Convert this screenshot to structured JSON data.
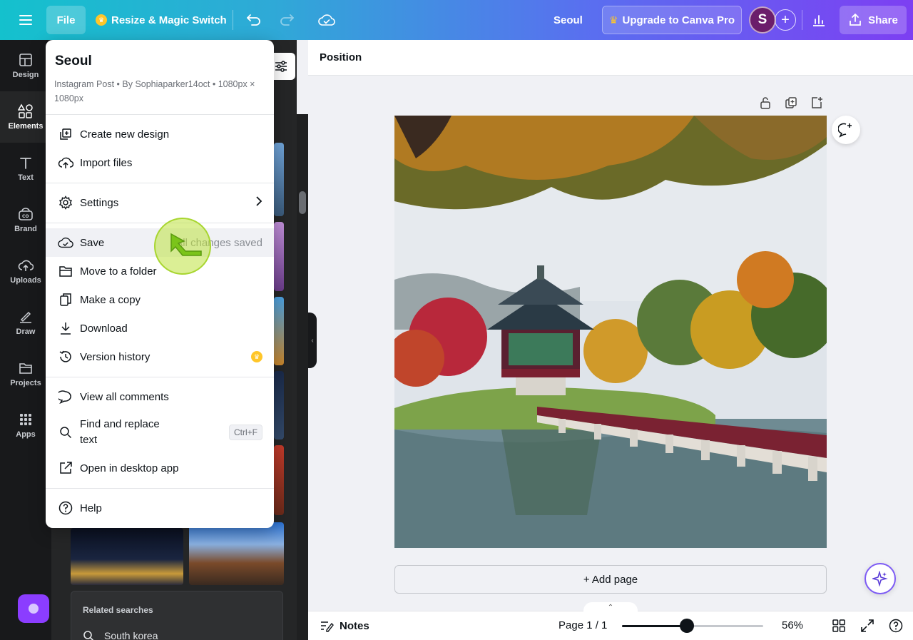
{
  "topbar": {
    "file_label": "File",
    "resize_label": "Resize & Magic Switch",
    "doc_title": "Seoul",
    "upgrade_label": "Upgrade to Canva Pro",
    "avatar_initial": "S",
    "share_label": "Share",
    "icons": [
      "menu-icon",
      "crown-icon",
      "undo-icon",
      "redo-icon",
      "cloud-check-icon",
      "plus-icon",
      "chart-icon",
      "share-icon"
    ]
  },
  "rail": {
    "items": [
      {
        "label": "Design",
        "icon": "layout-icon"
      },
      {
        "label": "Elements",
        "icon": "shapes-icon",
        "active": true
      },
      {
        "label": "Text",
        "icon": "text-icon"
      },
      {
        "label": "Brand",
        "icon": "brand-icon"
      },
      {
        "label": "Uploads",
        "icon": "upload-cloud-icon"
      },
      {
        "label": "Draw",
        "icon": "pen-icon"
      },
      {
        "label": "Projects",
        "icon": "folder-icon"
      },
      {
        "label": "Apps",
        "icon": "grid-icon"
      }
    ]
  },
  "panel": {
    "related_title": "Related searches",
    "related_items": [
      "South korea"
    ]
  },
  "menu": {
    "title": "Seoul",
    "meta": "Instagram Post • By Sophiaparker14oct • 1080px × 1080px",
    "items": [
      {
        "label": "Create new design",
        "icon": "create-design-icon"
      },
      {
        "label": "Import files",
        "icon": "import-cloud-icon"
      },
      {
        "label": "Settings",
        "icon": "gear-icon",
        "right": "chevron-right-icon"
      },
      {
        "label": "Save",
        "icon": "cloud-check-icon",
        "right_text": "All changes saved"
      },
      {
        "label": "Move to a folder",
        "icon": "folder-icon"
      },
      {
        "label": "Make a copy",
        "icon": "copy-icon"
      },
      {
        "label": "Download",
        "icon": "download-icon"
      },
      {
        "label": "Version history",
        "icon": "history-icon",
        "right": "crown-icon"
      },
      {
        "label": "View all comments",
        "icon": "comment-icon"
      },
      {
        "label": "Find and replace text",
        "icon": "search-icon",
        "shortcut": "Ctrl+F"
      },
      {
        "label": "Open in desktop app",
        "icon": "external-link-icon"
      },
      {
        "label": "Help",
        "icon": "help-icon"
      }
    ]
  },
  "editor": {
    "toolbar_label": "Position",
    "add_page_label": "+ Add page",
    "canvas_image": "Gyeongbokgung Hyangwonjeong pavilion with autumn trees and bridge reflected in pond"
  },
  "bottombar": {
    "notes_label": "Notes",
    "page_info": "Page 1 / 1",
    "zoom_percent": 56,
    "zoom_label": "56%"
  },
  "colors": {
    "topbar_gradient_start": "#14c1cd",
    "topbar_gradient_end": "#7d3ff2",
    "rail_bg": "#18191b",
    "panel_bg": "#252627",
    "accent_purple": "#8b3dff",
    "crown": "#ffc629",
    "cursor_highlight": "#bde23e"
  }
}
